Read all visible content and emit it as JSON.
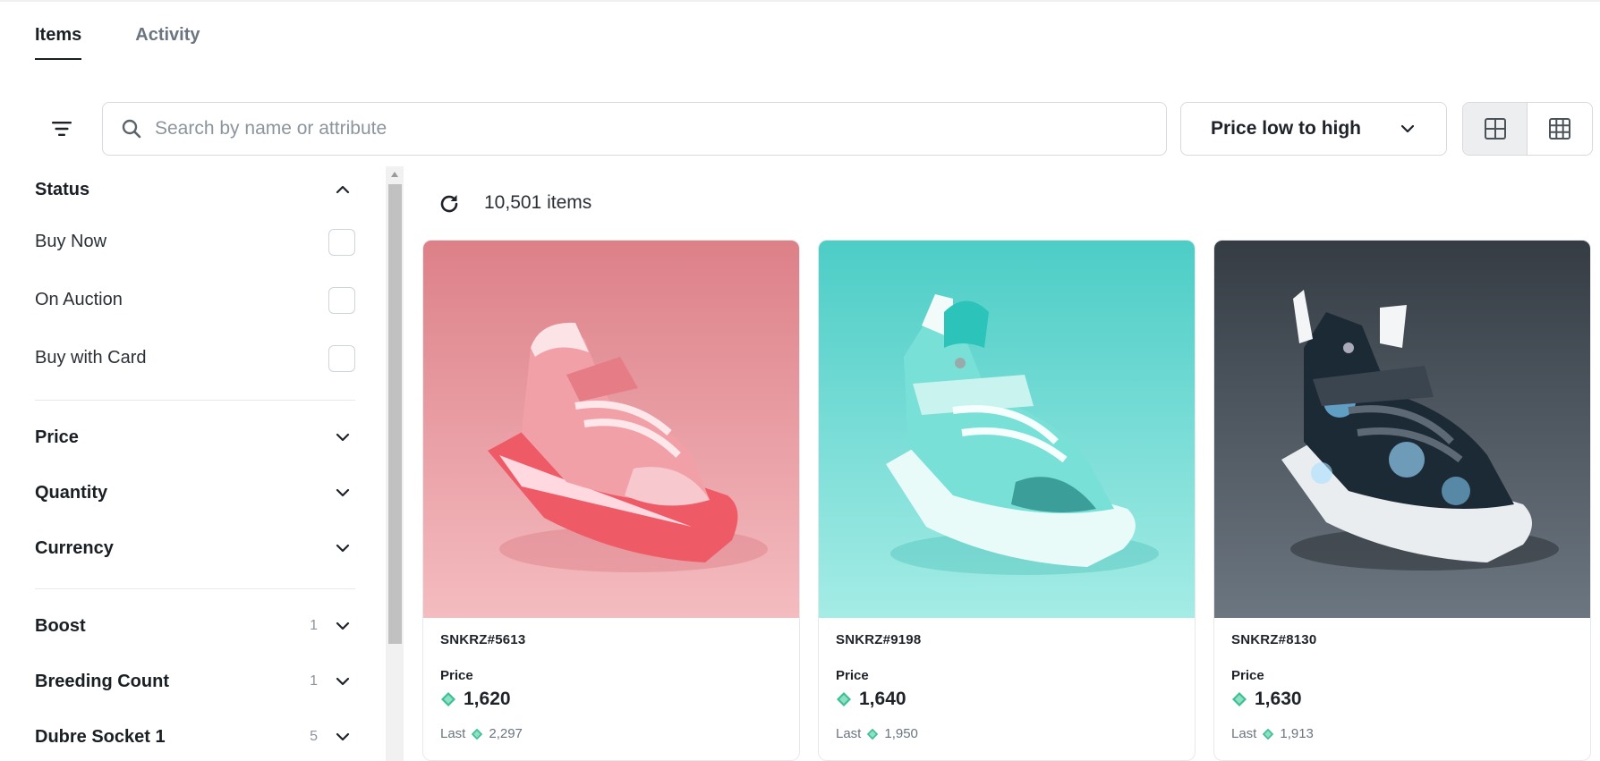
{
  "tabs": [
    {
      "label": "Items",
      "active": true
    },
    {
      "label": "Activity",
      "active": false
    }
  ],
  "search": {
    "placeholder": "Search by name or attribute",
    "value": ""
  },
  "sort": {
    "label": "Price low to high"
  },
  "view_toggle": {
    "active": "large-grid-icon"
  },
  "sidebar": {
    "status": {
      "title": "Status",
      "expanded": true,
      "options": [
        {
          "label": "Buy Now",
          "checked": false
        },
        {
          "label": "On Auction",
          "checked": false
        },
        {
          "label": "Buy with Card",
          "checked": false
        }
      ]
    },
    "filters": [
      {
        "title": "Price"
      },
      {
        "title": "Quantity"
      },
      {
        "title": "Currency"
      }
    ],
    "attributes": [
      {
        "title": "Boost",
        "count": "1"
      },
      {
        "title": "Breeding Count",
        "count": "1"
      },
      {
        "title": "Dubre Socket 1",
        "count": "5"
      }
    ]
  },
  "results": {
    "count_text": "10,501 items"
  },
  "cards": [
    {
      "name": "SNKRZ#5613",
      "price_label": "Price",
      "price": "1,620",
      "last_label": "Last",
      "last_price": "2,297",
      "theme": "pink"
    },
    {
      "name": "SNKRZ#9198",
      "price_label": "Price",
      "price": "1,640",
      "last_label": "Last",
      "last_price": "1,950",
      "theme": "teal"
    },
    {
      "name": "SNKRZ#8130",
      "price_label": "Price",
      "price": "1,630",
      "last_label": "Last",
      "last_price": "1,913",
      "theme": "dark"
    }
  ],
  "colors": {
    "token": "#3dbf95",
    "pink_bg": "#e99aa0",
    "teal_bg": "#5fd6cf",
    "dark_bg": "#4a535c"
  }
}
